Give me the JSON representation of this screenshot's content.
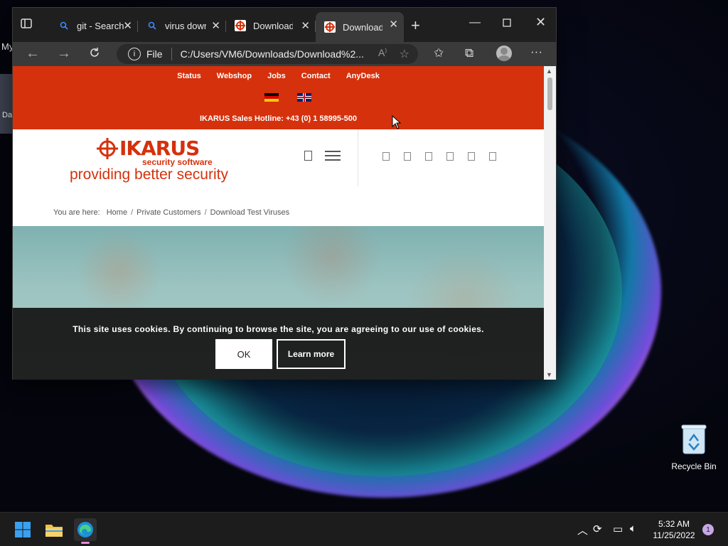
{
  "desktop": {
    "left_label": "My",
    "left_tile_label": "Da",
    "recycle_bin_label": "Recycle Bin"
  },
  "browser": {
    "tabs": [
      {
        "label": "git - Search",
        "icon": "search-icon",
        "active": false
      },
      {
        "label": "virus download",
        "icon": "search-icon",
        "active": false
      },
      {
        "label": "Download Test",
        "icon": "ikarus-favicon",
        "active": false
      },
      {
        "label": "Download Test",
        "icon": "ikarus-favicon",
        "active": true
      }
    ],
    "address": {
      "scheme_label": "File",
      "url": "C:/Users/VM6/Downloads/Download%2..."
    }
  },
  "site": {
    "topnav": [
      "Status",
      "Webshop",
      "Jobs",
      "Contact",
      "AnyDesk"
    ],
    "hotline": "IKARUS Sales Hotline: +43 (0) 1 58995-500",
    "logo_word": "IKARUS",
    "logo_sub": "security software",
    "tagline": "providing better security",
    "breadcrumb": {
      "label": "You are here:",
      "items": [
        "Home",
        "Private Customers",
        "Download Test Viruses"
      ]
    },
    "cookie": {
      "text": "This site uses cookies. By continuing to browse the site, you are agreeing to our use of cookies.",
      "ok_label": "OK",
      "learn_label": "Learn more"
    }
  },
  "taskbar": {
    "time": "5:32 AM",
    "date": "11/25/2022",
    "notifications": "1"
  },
  "colors": {
    "brand_red": "#d5310c",
    "cookie_bg": "#141414"
  }
}
